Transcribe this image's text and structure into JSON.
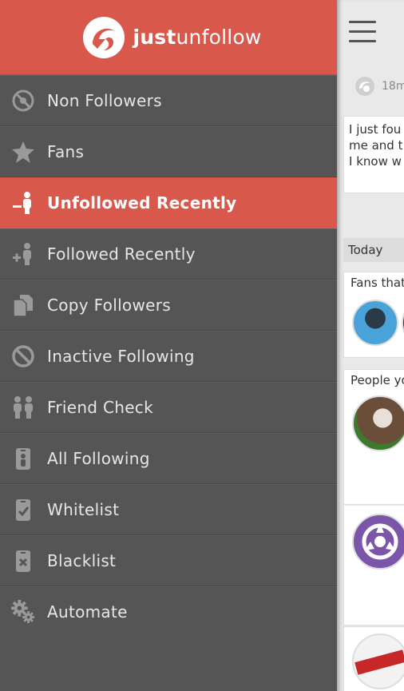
{
  "app": {
    "logo_bold": "just",
    "logo_light": "unfollow",
    "brand_color": "#d9584c",
    "drawer_bg": "#555555"
  },
  "menu": [
    {
      "label": "Non Followers",
      "icon": "non-followers-icon",
      "active": false
    },
    {
      "label": "Fans",
      "icon": "star-icon",
      "active": false
    },
    {
      "label": "Unfollowed Recently",
      "icon": "unfollow-user-icon",
      "active": true
    },
    {
      "label": "Followed Recently",
      "icon": "follow-user-icon",
      "active": false
    },
    {
      "label": "Copy Followers",
      "icon": "copy-icon",
      "active": false
    },
    {
      "label": "Inactive Following",
      "icon": "inactive-icon",
      "active": false
    },
    {
      "label": "Friend Check",
      "icon": "friends-icon",
      "active": false
    },
    {
      "label": "All Following",
      "icon": "id-badge-icon",
      "active": false
    },
    {
      "label": "Whitelist",
      "icon": "whitelist-icon",
      "active": false
    },
    {
      "label": "Blacklist",
      "icon": "blacklist-icon",
      "active": false
    },
    {
      "label": "Automate",
      "icon": "gears-icon",
      "active": false
    }
  ],
  "main": {
    "timestamp": "18m",
    "tweet_lines": [
      "I just fou",
      "me and t",
      "I know w"
    ],
    "section_label": "Today",
    "card1_title": "Fans that",
    "card2_title": "People yo"
  }
}
